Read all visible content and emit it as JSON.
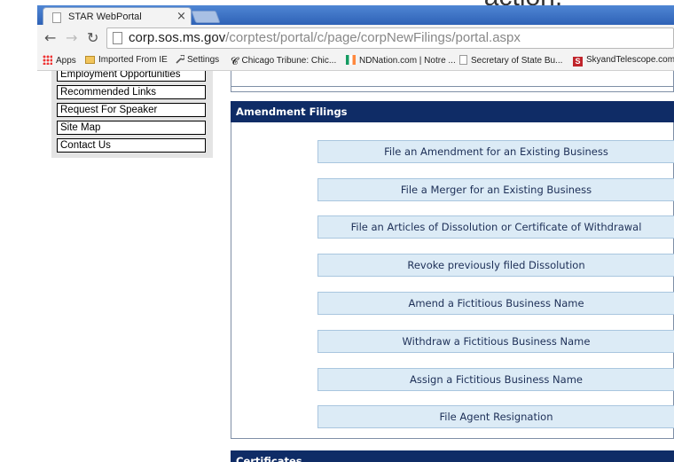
{
  "slide": {
    "partial_title": "action."
  },
  "browser": {
    "tab_title": "STAR WebPortal",
    "tab_close": "×",
    "url_host": "corp.sos.ms.gov",
    "url_path": "/corptest/portal/c/page/corpNewFilings/portal.aspx",
    "back_icon": "arrow-left-icon",
    "forward_icon": "arrow-right-icon",
    "reload_icon": "reload-icon"
  },
  "bookmarks": [
    {
      "label": "Apps",
      "icon": "apps-grid-icon"
    },
    {
      "label": "Imported From IE",
      "icon": "folder-icon"
    },
    {
      "label": "Settings",
      "icon": "wrench-icon"
    },
    {
      "label": "Chicago Tribune: Chic...",
      "icon": "tribune-icon"
    },
    {
      "label": "NDNation.com | Notre ...",
      "icon": "ndnation-icon"
    },
    {
      "label": "Secretary of State  Bu...",
      "icon": "page-icon"
    },
    {
      "label": "SkyandTelescope.com...",
      "icon": "skytelescope-icon"
    }
  ],
  "sidebar": {
    "items": [
      "Employment Opportunities",
      "Recommended Links",
      "Request For Speaker",
      "Site Map",
      "Contact Us"
    ]
  },
  "sections": {
    "amendment_header": "Amendment Filings",
    "certificates_header": "Certificates"
  },
  "actions": [
    "File an Amendment for an Existing Business",
    "File a Merger for an Existing Business",
    "File an Articles of Dissolution or Certificate of Withdrawal",
    "Revoke previously filed Dissolution",
    "Amend a Fictitious Business Name",
    "Withdraw a Fictitious Business Name",
    "Assign a Fictitious Business Name",
    "File Agent Resignation"
  ],
  "colors": {
    "header_bg": "#0f2c66",
    "button_bg": "#dcebf6",
    "tabstrip": "#3a74c9"
  }
}
